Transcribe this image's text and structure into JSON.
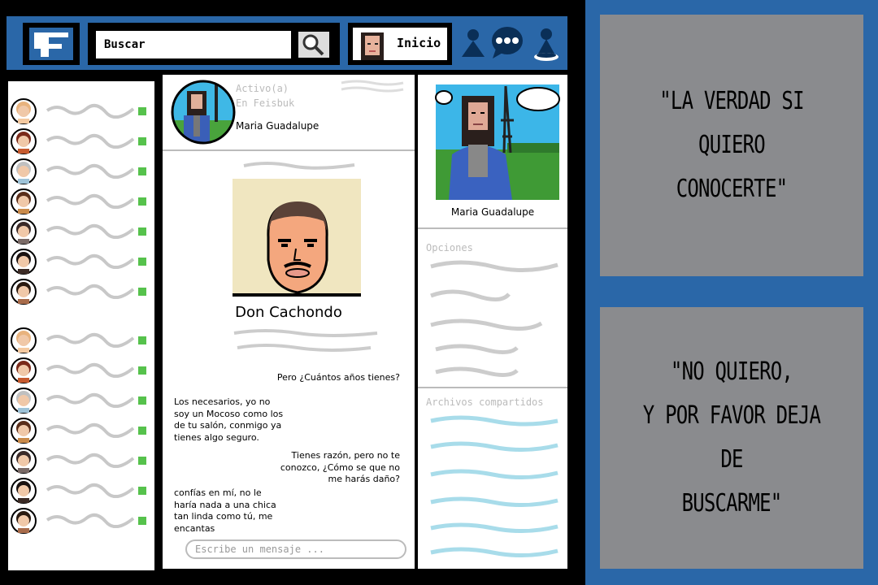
{
  "header": {
    "search": {
      "value": "Buscar"
    },
    "home_label": "Inicio",
    "icons": [
      "facebook-logo-icon",
      "search-icon",
      "friends-icon",
      "messages-icon",
      "notifications-icon"
    ],
    "accent_color": "#2a67a8"
  },
  "contacts": {
    "groups": 2,
    "per_group": 7,
    "total": 14,
    "online_color": "#56c24c"
  },
  "chat": {
    "status_line1": "Activo(a)",
    "status_line2": "En Feisbuk",
    "contact_name": "Maria Guadalupe",
    "profile_name": "Don Cachondo",
    "messages": [
      {
        "from": "other",
        "text": "Pero ¿Cuántos años tienes?"
      },
      {
        "from": "me",
        "lines": [
          "Los necesarios, yo no",
          "soy un Mocoso como los",
          "de tu salón, conmigo ya",
          "tienes algo seguro."
        ]
      },
      {
        "from": "other",
        "lines": [
          "Tienes razón, pero no te",
          "conozco, ¿Cómo se que no",
          "me harás daño?"
        ]
      },
      {
        "from": "me",
        "lines": [
          "confías en mí, no le",
          "haría nada a una chica",
          "tan linda como tú, me",
          "encantas"
        ]
      }
    ],
    "composer_placeholder": "Escribe un mensaje ..."
  },
  "sidebar_right": {
    "profile_name": "Maria Guadalupe",
    "options_title": "Opciones",
    "files_title": "Archivos compartidos"
  },
  "quotes": {
    "first": [
      "\"LA VERDAD SI QUIERO",
      "CONOCERTE\""
    ],
    "second": [
      "\"NO QUIERO,",
      "Y POR FAVOR DEJA DE",
      "BUSCARME\""
    ],
    "panel_color": "#8a8b8e"
  }
}
